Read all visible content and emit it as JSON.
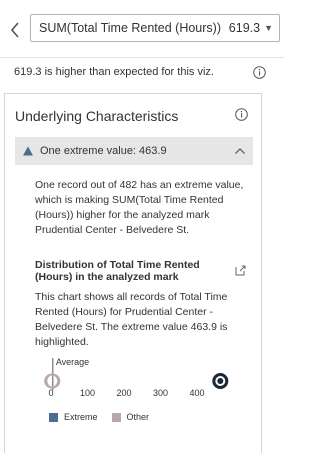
{
  "header": {
    "back_icon": "chevron-left-icon",
    "dropdown_label": "SUM(Total Time Rented (Hours))",
    "dropdown_value": "619.3",
    "dropdown_arrow_icon": "caret-down-icon"
  },
  "summary": {
    "text": "619.3 is higher than expected for this viz.",
    "info_icon": "info-icon"
  },
  "card": {
    "title": "Underlying Characteristics",
    "info_icon": "info-icon",
    "section": {
      "label": "One extreme value: 463.9",
      "warning_icon": "warning-triangle-icon",
      "chevron_icon": "chevron-up-icon",
      "description": "One record out of 482 has an extreme value, which is making SUM(Total Time Rented (Hours)) higher for the analyzed mark Prudential Center - Belvedere St.",
      "distribution_title": "Distribution of Total Time Rented (Hours) in the analyzed mark",
      "open_icon": "open-external-icon",
      "distribution_description": "This chart shows all records of Total Time Rented (Hours) for Prudential Center - Belvedere St. The extreme value 463.9 is highlighted."
    }
  },
  "chart_data": {
    "type": "scatter",
    "xlim": [
      0,
      400
    ],
    "ticks": [
      "0",
      "100",
      "200",
      "300",
      "400"
    ],
    "average_label": "Average",
    "average_value": 5,
    "other_points": [
      1,
      2,
      3,
      4,
      5,
      6
    ],
    "extreme_points": [
      463.9
    ],
    "legend": [
      {
        "name": "Extreme",
        "color": "#4b6d8f"
      },
      {
        "name": "Other",
        "color": "#b8a8a8"
      }
    ]
  },
  "colors": {
    "accent": "#4b6d8f",
    "other": "#b8a8a8",
    "section_bg": "#e6e6e6"
  }
}
